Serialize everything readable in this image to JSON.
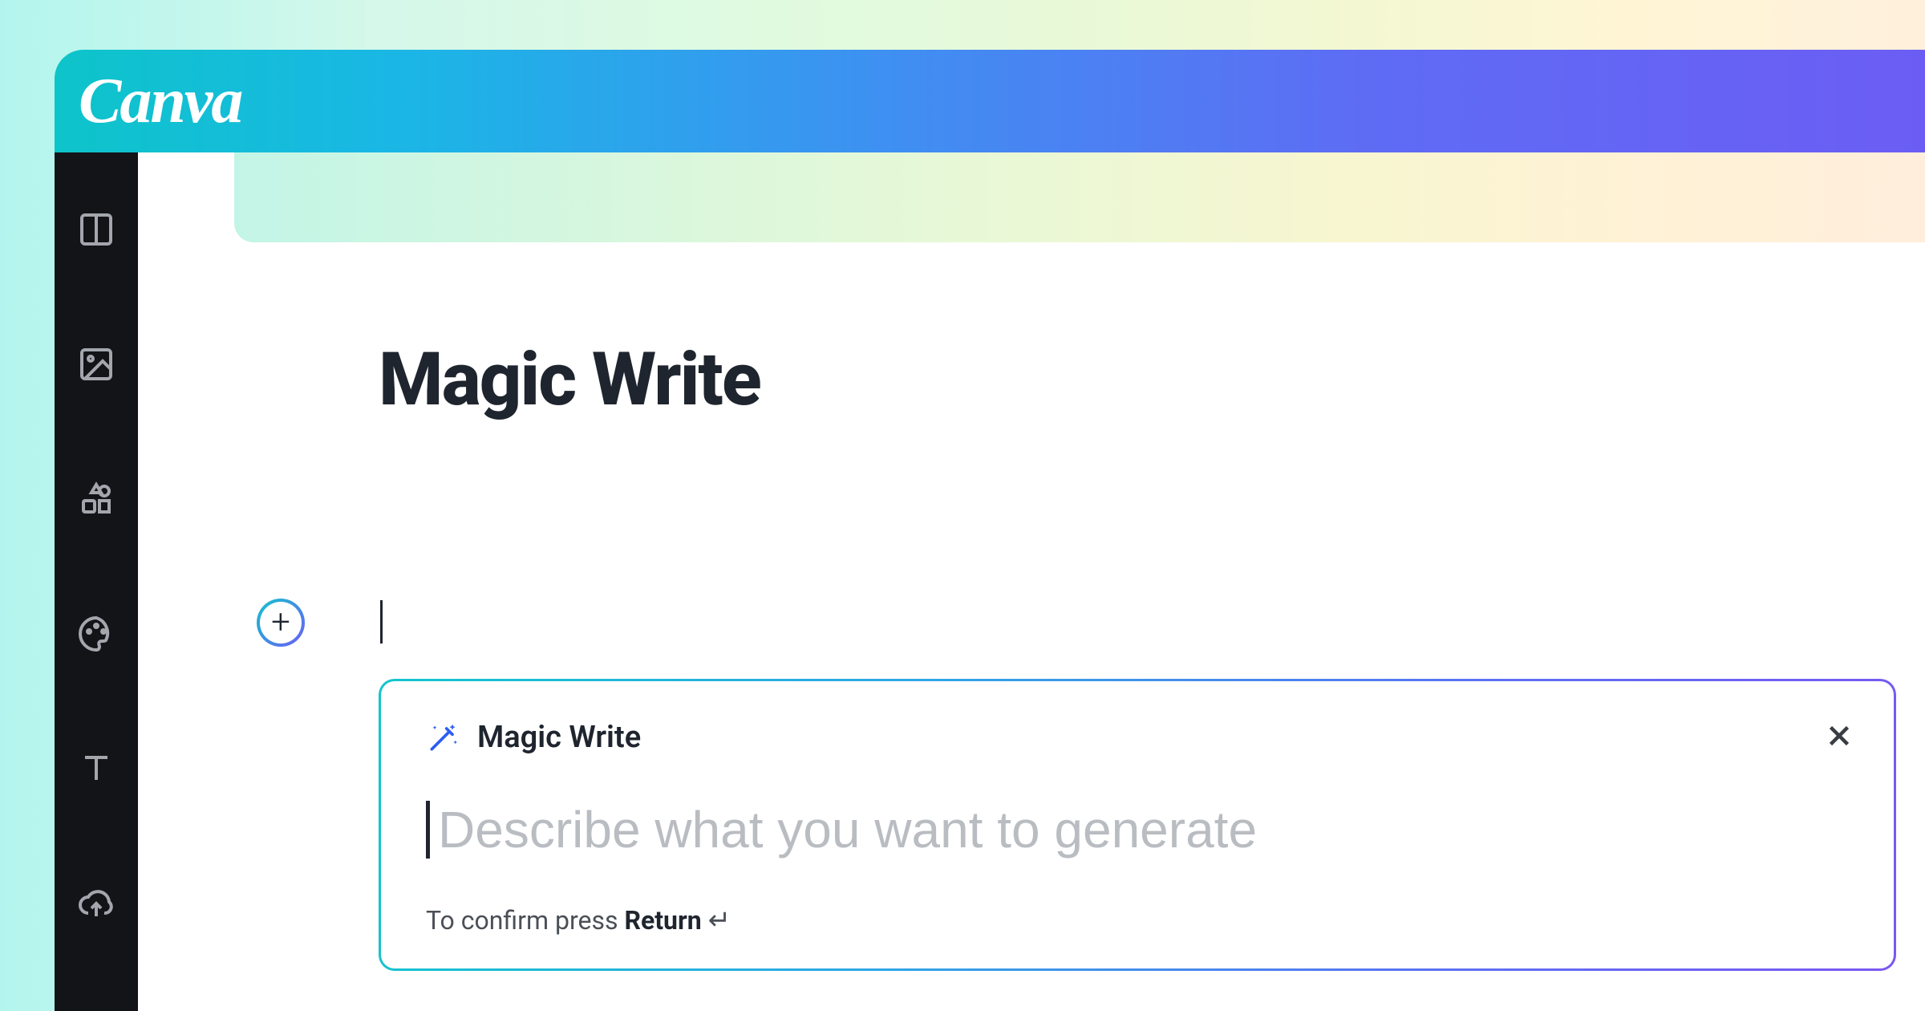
{
  "brand": {
    "logo_text": "Canva"
  },
  "sidebar": {
    "items": [
      {
        "name": "templates",
        "icon": "layout-icon"
      },
      {
        "name": "photos",
        "icon": "image-icon"
      },
      {
        "name": "elements",
        "icon": "shapes-icon"
      },
      {
        "name": "styles",
        "icon": "palette-icon"
      },
      {
        "name": "text",
        "icon": "text-icon"
      },
      {
        "name": "uploads",
        "icon": "upload-cloud-icon"
      }
    ]
  },
  "page": {
    "title": "Magic Write"
  },
  "add_button": {
    "symbol": "+"
  },
  "magic_panel": {
    "label": "Magic Write",
    "input_value": "",
    "input_placeholder": "Describe what you want to generate",
    "hint_prefix": "To confirm press ",
    "hint_key": "Return",
    "return_glyph": "↵"
  }
}
